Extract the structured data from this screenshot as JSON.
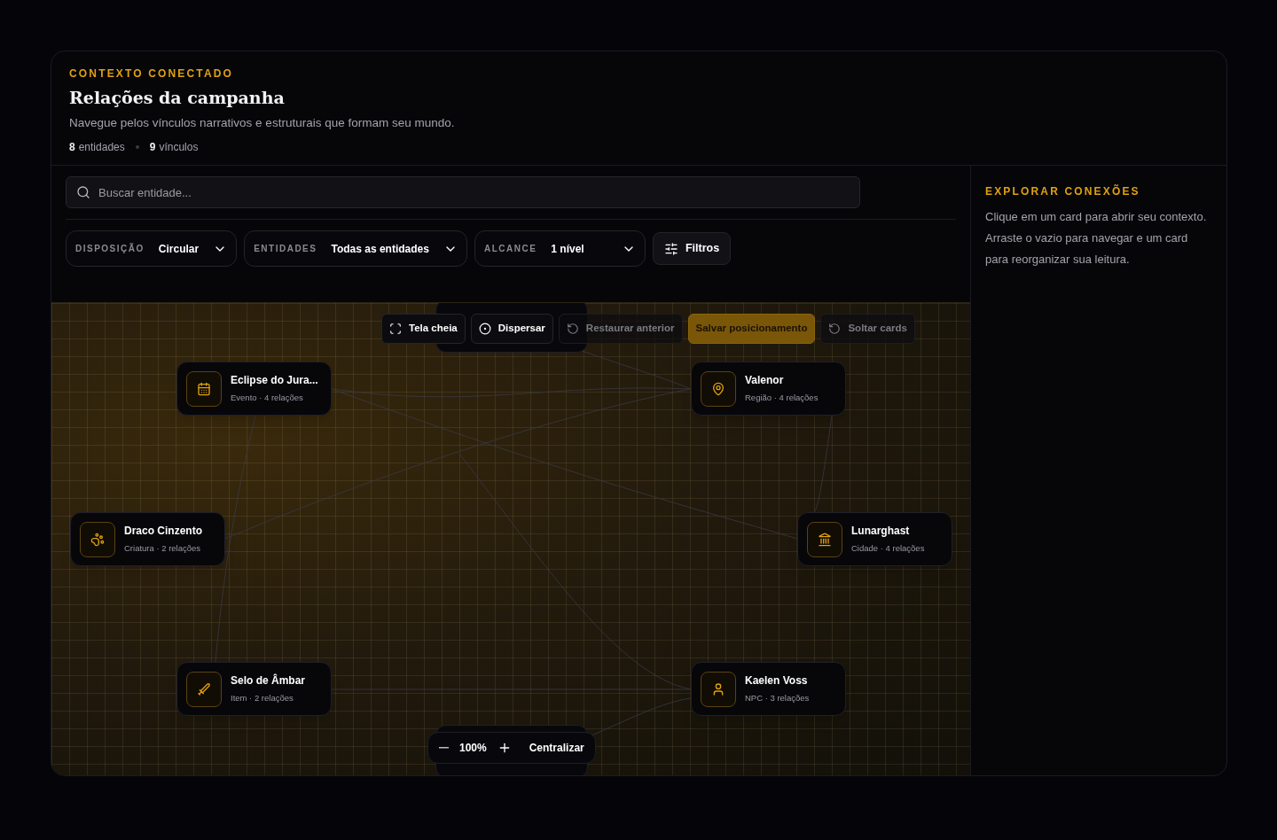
{
  "header": {
    "eyebrow": "CONTEXTO CONECTADO",
    "title": "Relações da campanha",
    "subtitle": "Navegue pelos vínculos narrativos e estruturais que formam seu mundo.",
    "stats": [
      {
        "value": "8",
        "label": "entidades"
      },
      {
        "value": "9",
        "label": "vínculos"
      }
    ]
  },
  "search": {
    "placeholder": "Buscar entidade..."
  },
  "filters": [
    {
      "label": "DISPOSIÇÃO",
      "value": "Circular"
    },
    {
      "label": "ENTIDADES",
      "value": "Todas as entidades"
    },
    {
      "label": "ALCANCE",
      "value": "1 nível"
    }
  ],
  "filters_button": "Filtros",
  "toolbar": [
    {
      "kind": "fullscreen",
      "label": "Tela cheia",
      "disabled": false,
      "primary": false
    },
    {
      "kind": "scatter",
      "label": "Dispersar",
      "disabled": false,
      "primary": false
    },
    {
      "kind": "undo",
      "label": "Restaurar anterior",
      "disabled": true,
      "primary": false
    },
    {
      "kind": "save",
      "label": "Salvar posicionamento",
      "disabled": false,
      "primary": true
    },
    {
      "kind": "undo",
      "label": "Soltar cards",
      "disabled": true,
      "primary": false
    }
  ],
  "nodes": [
    {
      "kind": "event",
      "name": "Eclipse do Jura...",
      "meta": "Evento · 4 relações"
    },
    {
      "kind": "region",
      "name": "Valenor",
      "meta": "Região · 4 relações"
    },
    {
      "kind": "creature",
      "name": "Draco Cinzento",
      "meta": "Criatura · 2 relações"
    },
    {
      "kind": "city",
      "name": "Lunarghast",
      "meta": "Cidade · 4 relações"
    },
    {
      "kind": "item",
      "name": "Selo de Âmbar",
      "meta": "Item · 2 relações"
    },
    {
      "kind": "npc",
      "name": "Kaelen Voss",
      "meta": "NPC · 3 relações"
    }
  ],
  "zoom": {
    "value": "100%",
    "center_label": "Centralizar"
  },
  "sidebar": {
    "title": "EXPLORAR CONEXÕES",
    "text": "Clique em um card para abrir seu contexto. Arraste o vazio para navegar e um card para reorganizar sua leitura."
  }
}
